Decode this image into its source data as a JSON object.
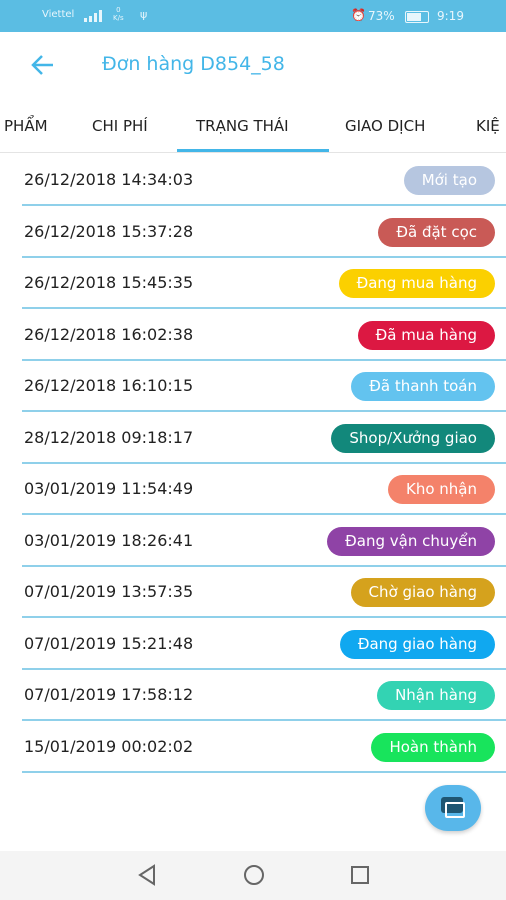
{
  "status_bar": {
    "carrier": "Viettel",
    "speed_value": "0",
    "speed_unit": "K/s",
    "battery": "73%",
    "battery_level": 0.73,
    "time": "9:19"
  },
  "header": {
    "title": "Đơn hàng D854_58"
  },
  "tabs": [
    "PHẨM",
    "CHI PHÍ",
    "TRẠNG THÁI",
    "GIAO DỊCH",
    "KIỆ"
  ],
  "active_tab": "TRẠNG THÁI",
  "rows": [
    {
      "date": "26/12/2018 14:34:03",
      "status": "Mới tạo",
      "color": "#b6c6e0"
    },
    {
      "date": "26/12/2018 15:37:28",
      "status": "Đã đặt cọc",
      "color": "#c95a56"
    },
    {
      "date": "26/12/2018 15:45:35",
      "status": "Đang mua hàng",
      "color": "#fbd000"
    },
    {
      "date": "26/12/2018 16:02:38",
      "status": "Đã mua hàng",
      "color": "#dc1842"
    },
    {
      "date": "26/12/2018 16:10:15",
      "status": "Đã thanh toán",
      "color": "#63c3ef"
    },
    {
      "date": "28/12/2018 09:18:17",
      "status": "Shop/Xưởng giao",
      "color": "#12887b"
    },
    {
      "date": "03/01/2019 11:54:49",
      "status": "Kho nhận",
      "color": "#f4826a"
    },
    {
      "date": "03/01/2019 18:26:41",
      "status": "Đang vận chuyển",
      "color": "#8f43a6"
    },
    {
      "date": "07/01/2019 13:57:35",
      "status": "Chờ giao hàng",
      "color": "#d5a21d"
    },
    {
      "date": "07/01/2019 15:21:48",
      "status": "Đang giao hàng",
      "color": "#10a8f0"
    },
    {
      "date": "07/01/2019 17:58:12",
      "status": "Nhận hàng",
      "color": "#33d3b3"
    },
    {
      "date": "15/01/2019 00:02:02",
      "status": "Hoàn thành",
      "color": "#18e45c"
    }
  ],
  "icons": {
    "back": "arrow-left-icon",
    "fab": "chat-icon",
    "nav_back": "triangle-back-icon",
    "nav_home": "circle-home-icon",
    "nav_recent": "square-recent-icon"
  }
}
